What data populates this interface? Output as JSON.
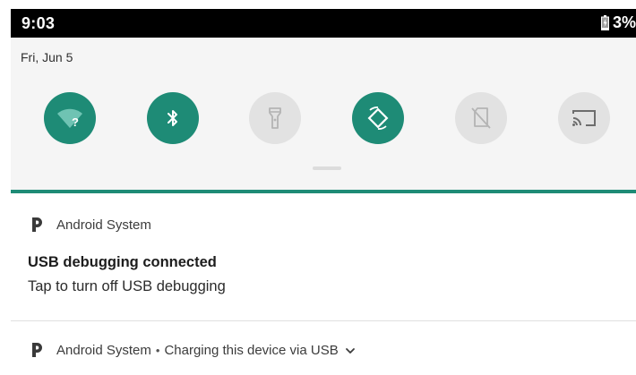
{
  "status_bar": {
    "time": "9:03",
    "battery_percent": "3%",
    "battery_icon": "battery-charging-icon"
  },
  "quick_settings": {
    "date": "Fri, Jun 5",
    "tiles": [
      {
        "name": "wifi",
        "icon": "wifi-question-icon",
        "state": "on"
      },
      {
        "name": "bluetooth",
        "icon": "bluetooth-icon",
        "state": "on"
      },
      {
        "name": "flashlight",
        "icon": "flashlight-icon",
        "state": "off"
      },
      {
        "name": "auto-rotate",
        "icon": "auto-rotate-icon",
        "state": "on"
      },
      {
        "name": "no-sim",
        "icon": "no-sim-icon",
        "state": "off"
      },
      {
        "name": "cast",
        "icon": "cast-icon",
        "state": "off"
      }
    ]
  },
  "colors": {
    "accent": "#1e8b76",
    "tile_off": "#e2e2e2",
    "panel_bg": "#f5f5f5",
    "status_bar_bg": "#000000"
  },
  "notifications": [
    {
      "app_name": "Android System",
      "app_icon": "android-system-p-icon",
      "title": "USB debugging connected",
      "text": "Tap to turn off USB debugging"
    },
    {
      "app_name": "Android System",
      "app_icon": "android-system-p-icon",
      "separator": "•",
      "summary": "Charging this device via USB",
      "expand_icon": "chevron-down-icon"
    }
  ]
}
